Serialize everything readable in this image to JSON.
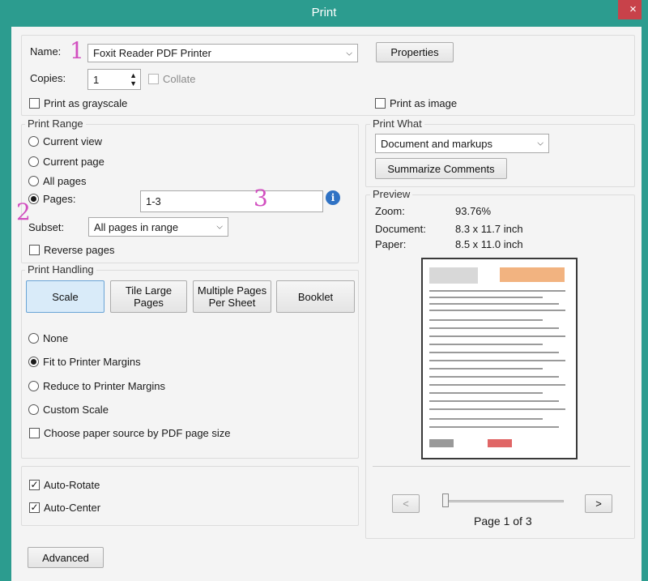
{
  "window": {
    "title": "Print",
    "close_glyph": "×"
  },
  "printer": {
    "name_label": "Name:",
    "name_value": "Foxit Reader PDF Printer",
    "properties_label": "Properties",
    "copies_label": "Copies:",
    "copies_value": "1",
    "collate_label": "Collate",
    "collate_checked": false,
    "grayscale_label": "Print as grayscale",
    "grayscale_checked": false,
    "print_as_image_label": "Print as image",
    "print_as_image_checked": false
  },
  "annotations": {
    "one": "1",
    "two": "2",
    "three": "3",
    "color": "#d24fc0"
  },
  "print_range": {
    "legend": "Print Range",
    "options": [
      {
        "label": "Current view",
        "checked": false
      },
      {
        "label": "Current page",
        "checked": false
      },
      {
        "label": "All pages",
        "checked": false
      },
      {
        "label": "Pages:",
        "checked": true
      }
    ],
    "pages_value": "1-3",
    "info_icon": "info-icon",
    "subset_label": "Subset:",
    "subset_value": "All pages in range",
    "reverse_label": "Reverse pages",
    "reverse_checked": false
  },
  "print_what": {
    "legend": "Print What",
    "value": "Document and markups",
    "summarize_label": "Summarize Comments"
  },
  "print_handling": {
    "legend": "Print Handling",
    "tabs": [
      {
        "label": "Scale",
        "selected": true
      },
      {
        "label": "Tile Large Pages",
        "selected": false
      },
      {
        "label": "Multiple Pages Per Sheet",
        "selected": false
      },
      {
        "label": "Booklet",
        "selected": false
      }
    ],
    "options": [
      {
        "label": "None",
        "checked": false
      },
      {
        "label": "Fit to Printer Margins",
        "checked": true
      },
      {
        "label": "Reduce to Printer Margins",
        "checked": false
      },
      {
        "label": "Custom Scale",
        "checked": false
      }
    ],
    "paper_source_label": "Choose paper source by PDF page size",
    "paper_source_checked": false
  },
  "orientation": {
    "auto_rotate_label": "Auto-Rotate",
    "auto_rotate_checked": true,
    "auto_center_label": "Auto-Center",
    "auto_center_checked": true
  },
  "preview": {
    "legend": "Preview",
    "zoom_label": "Zoom:",
    "zoom_value": "93.76%",
    "document_label": "Document:",
    "document_value": "8.3 x 11.7 inch",
    "paper_label": "Paper:",
    "paper_value": "8.5 x 11.0 inch",
    "prev_glyph": "<",
    "next_glyph": ">",
    "page_indicator": "Page 1 of 3",
    "slider_position": 0
  },
  "advanced_label": "Advanced",
  "colors": {
    "chrome": "#2c9c8f",
    "close": "#c8424a",
    "selected_tab": "#d9ebf9"
  }
}
